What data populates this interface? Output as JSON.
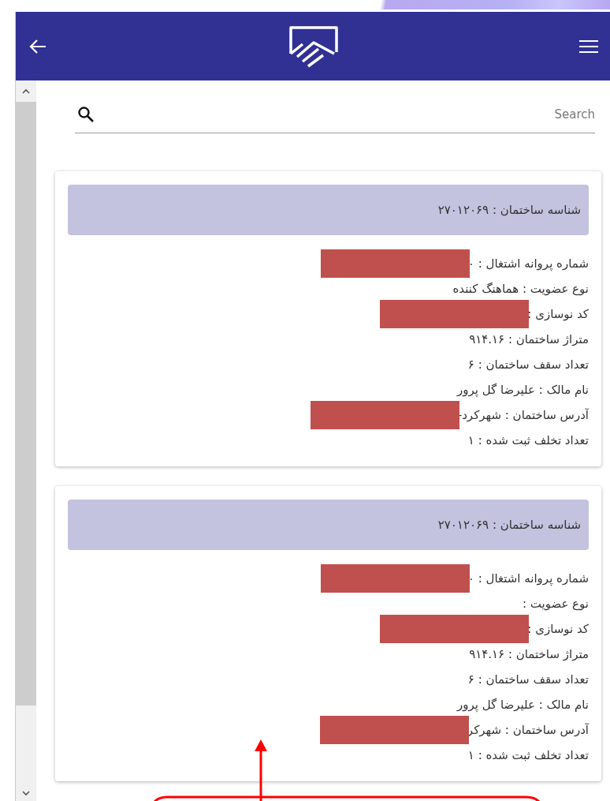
{
  "search": {
    "placeholder": "Search"
  },
  "cards": [
    {
      "title": "شناسه ساختمان : ۲۷۰۱۲۰۶۹",
      "lines": [
        {
          "text": "شماره پروانه اشتغال : ۰",
          "redacted": true
        },
        {
          "text": "نوع عضویت : هماهنگ کننده",
          "redacted": false
        },
        {
          "text": "کد نوسازی :",
          "redacted": true
        },
        {
          "text": "متراژ ساختمان : ۹۱۴.۱۶",
          "redacted": false
        },
        {
          "text": "تعداد سقف ساختمان : ۶",
          "redacted": false
        },
        {
          "text": "نام مالک : علیرضا گل پرور",
          "redacted": false
        },
        {
          "text": "آدرس ساختمان : شهرکرد-",
          "redacted": true
        },
        {
          "text": "تعداد تخلف ثبت شده : ۱",
          "redacted": false
        }
      ]
    },
    {
      "title": "شناسه ساختمان : ۲۷۰۱۲۰۶۹",
      "lines": [
        {
          "text": "شماره پروانه اشتغال : ۰",
          "redacted": true
        },
        {
          "text": "نوع عضویت :",
          "redacted": false
        },
        {
          "text": "کد نوسازی :",
          "redacted": true
        },
        {
          "text": "متراژ ساختمان : ۹۱۴.۱۶",
          "redacted": false
        },
        {
          "text": "تعداد سقف ساختمان : ۶",
          "redacted": false
        },
        {
          "text": "نام مالک : علیرضا گل پرور",
          "redacted": false
        },
        {
          "text": "آدرس ساختمان : شهرکر",
          "redacted": true
        },
        {
          "text": "تعداد تخلف ثبت شده : ۱",
          "redacted": false
        }
      ]
    }
  ]
}
